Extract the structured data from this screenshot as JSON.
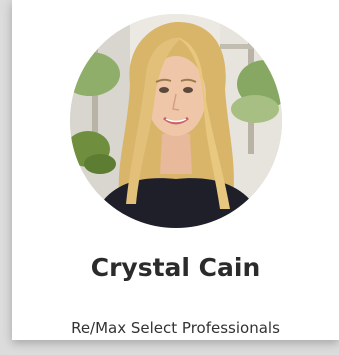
{
  "profile": {
    "name": "Crystal Cain",
    "company": "Re/Max Select Professionals"
  },
  "colors": {
    "card_background": "#ffffff",
    "page_background": "#dcdcdc",
    "name_text": "#2b2b2b",
    "company_text": "#333333"
  },
  "icons": {
    "photo": "agent-portrait"
  }
}
